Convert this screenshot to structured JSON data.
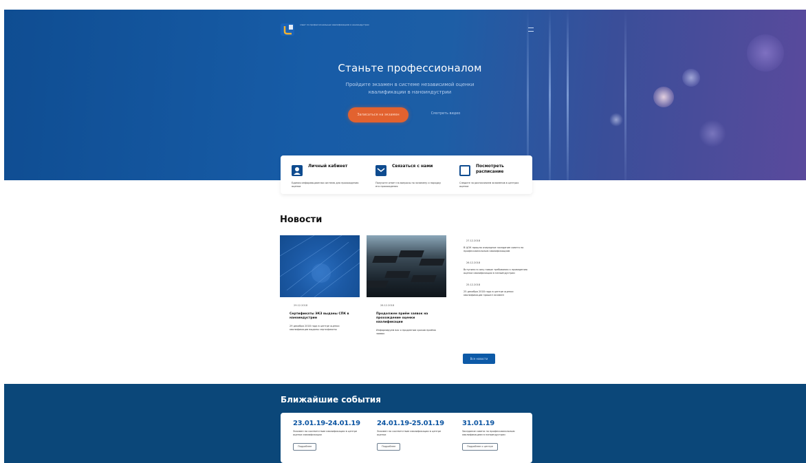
{
  "header": {
    "logo_text": "совет по профессиональным квалификациям в наноиндустрии",
    "menu_icon": "hamburger-icon"
  },
  "hero": {
    "title": "Станьте профессионалом",
    "subtitle": "Пройдите экзамен в системе независимой оценки квалификации в наноиндустрии",
    "primary_button": "Записаться на экзамен",
    "secondary_link": "Смотреть видео"
  },
  "quick_links": [
    {
      "title": "Личный кабинет",
      "description": "Единая информационная система для прохождения оценки",
      "icon": "user-icon"
    },
    {
      "title": "Связаться с нами",
      "description": "Получите ответ на вопросы по экзамену и порядку его прохождения",
      "icon": "mail-icon"
    },
    {
      "title": "Посмотреть расписание",
      "description": "Следите за расписанием экзаменов в центрах оценки",
      "icon": "calendar-icon"
    }
  ],
  "news": {
    "title": "Новости",
    "cards": [
      {
        "date": "29.12.2018",
        "headline": "Сертификаты ЭКЗ выданы СПК в наноиндустрии",
        "text": "29 декабря 2018 года в центре оценки квалификации выданы сертификаты"
      },
      {
        "date": "26.12.2018",
        "headline": "Продолжен приём заявок на прохождение оценки квалификации",
        "text": "Информируем вас о продлении сроков приёма заявок"
      }
    ],
    "list": [
      {
        "date": "27.12.2018",
        "text": "В ЦОК прошло очередное заседание совета по профессиональным квалификациям"
      },
      {
        "date": "26.12.2018",
        "text": "Вступили в силу новые требования к проведению оценки квалификации в наноиндустрии"
      },
      {
        "date": "25.12.2018",
        "text": "25 декабря 2018 года в центре оценки квалификации прошел экзамен"
      }
    ],
    "all_button": "Все новости"
  },
  "events": {
    "title": "Ближайшие события",
    "items": [
      {
        "date": "23.01.19-24.01.19",
        "text": "Экзамен на соответствие квалификации в центре оценки квалификации",
        "button": "Подробнее"
      },
      {
        "date": "24.01.19-25.01.19",
        "text": "Экзамен на соответствие квалификации в центре оценки",
        "button": "Подробнее"
      },
      {
        "date": "31.01.19",
        "text": "Заседание совета по профессиональным квалификациям в наноиндустрии",
        "button": "Подробнее о центре"
      }
    ]
  },
  "colors": {
    "primary_blue": "#0e4b8f",
    "accent_orange": "#e2622f",
    "events_bg": "#0b4779"
  }
}
